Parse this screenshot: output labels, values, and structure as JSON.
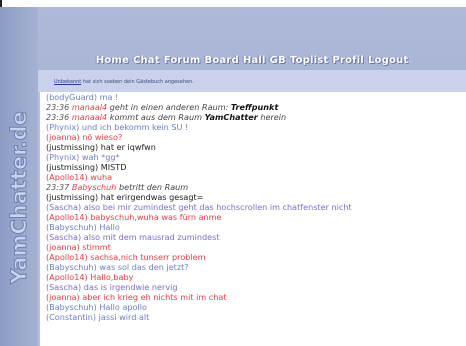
{
  "nav": {
    "items": [
      "Home",
      "Chat",
      "Forum",
      "Board",
      "Hall",
      "GB",
      "Toplist",
      "Profil",
      "Logout"
    ]
  },
  "notice": {
    "link": "Unbekannt",
    "text": "hat sich soeben dein Gästebuch angesehen."
  },
  "logo": {
    "text": "YamChatter.de"
  },
  "colors": {
    "frame": "#aeb9d8",
    "navText": "#ffffff",
    "timestamp": "#555555",
    "system": "#444444",
    "user_blue": "#6e7fc0",
    "user_red": "#e0414a",
    "user_black": "#222222",
    "user_purple": "#7b6fc4"
  },
  "chat": {
    "lines": [
      {
        "type": "msg",
        "user": "(bodyGuard)",
        "text": "ma !",
        "color": "user_blue"
      },
      {
        "type": "event",
        "time": "23:36",
        "user": "manaal4",
        "action": "geht in einen anderen Raum:",
        "target": "Treffpunkt"
      },
      {
        "type": "event",
        "time": "23:36",
        "user": "manaal4",
        "action": "kommt aus dem Raum",
        "target": "YamChatter",
        "tail": "herein"
      },
      {
        "type": "msg",
        "user": "(Phynix)",
        "text": "und ich bekomm kein SU !",
        "color": "user_blue"
      },
      {
        "type": "msg",
        "user": "(joanna)",
        "text": "nö wieso?",
        "color": "user_red"
      },
      {
        "type": "msg",
        "user": "(justmissing)",
        "text": "hat er iqwfwn",
        "color": "user_black"
      },
      {
        "type": "msg",
        "user": "(Phynix)",
        "text": "wah *gg*",
        "color": "user_blue"
      },
      {
        "type": "msg",
        "user": "(justmissing)",
        "text": "MISTD",
        "color": "user_black"
      },
      {
        "type": "msg",
        "user": "(Apollo14)",
        "text": "wuha",
        "color": "user_red"
      },
      {
        "type": "event2",
        "time": "23:37",
        "user": "Babyschuh",
        "action": "betritt den Raum"
      },
      {
        "type": "msg",
        "user": "(justmissing)",
        "text": "hat erirgendwas gesagt=",
        "color": "user_black"
      },
      {
        "type": "msg",
        "user": "(Sascha)",
        "text": "also bei mir zumindest geht das hochscrollen im chatfenster nicht",
        "color": "user_purple"
      },
      {
        "type": "msg",
        "user": "(Apollo14)",
        "text": "babyschuh,wuha was fürn anme",
        "color": "user_red"
      },
      {
        "type": "msg",
        "user": "(Babyschuh)",
        "text": "Hallo",
        "color": "user_blue"
      },
      {
        "type": "msg",
        "user": "(Sascha)",
        "text": "also mit dem mausrad zumindest",
        "color": "user_purple"
      },
      {
        "type": "msg",
        "user": "(joanna)",
        "text": "stimmt",
        "color": "user_red"
      },
      {
        "type": "msg",
        "user": "(Apollo14)",
        "text": "sachsa,nich tunserr problem",
        "color": "user_red"
      },
      {
        "type": "msg",
        "user": "(Babyschuh)",
        "text": "was sol das den jetzt?",
        "color": "user_blue"
      },
      {
        "type": "msg",
        "user": "(Apollo14)",
        "text": "Hallo,baby",
        "color": "user_red"
      },
      {
        "type": "msg",
        "user": "(Sascha)",
        "text": "das is irgendwie nervig",
        "color": "user_purple"
      },
      {
        "type": "msg",
        "user": "(joanna)",
        "text": "aber ich krieg eh nichts mit im chat",
        "color": "user_red"
      },
      {
        "type": "msg",
        "user": "(Babyschuh)",
        "text": "Hallo apollo",
        "color": "user_blue"
      },
      {
        "type": "msg",
        "user": "(Constantin)",
        "text": "jassi wird alt",
        "color": "user_blue"
      }
    ]
  }
}
